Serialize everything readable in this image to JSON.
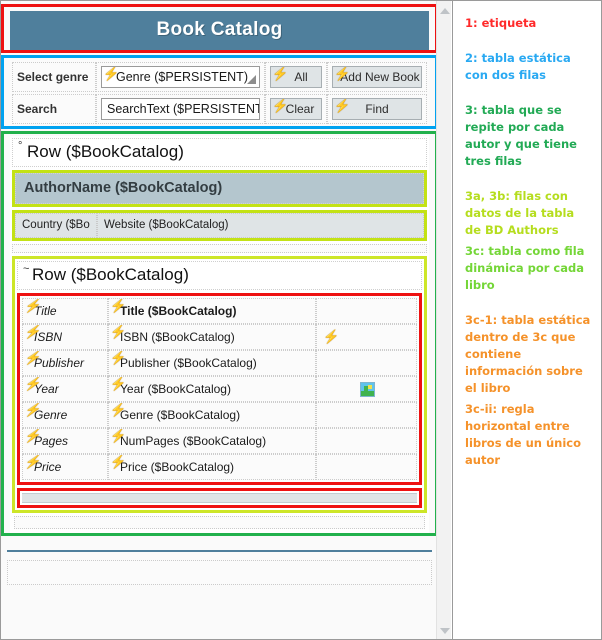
{
  "app": {
    "title": "Book Catalog"
  },
  "toolbar": {
    "select_genre_label": "Select genre",
    "genre_field_value": "Genre ($PERSISTENT)",
    "all_button": "All",
    "add_new_book_button": "Add New Book",
    "search_label": "Search",
    "search_field_value": "SearchText ($PERSISTENT)",
    "clear_button": "Clear",
    "find_button": "Find",
    "bolt_icon": "⚡"
  },
  "outer_row": {
    "mark": "°",
    "label": "Row ($BookCatalog)",
    "author_name": "AuthorName ($BookCatalog)",
    "country": "Country ($Bo",
    "website": "Website ($BookCatalog)"
  },
  "inner_row": {
    "mark": "~",
    "label": "Row ($BookCatalog)"
  },
  "detail_table": {
    "rows": [
      {
        "key": "Title",
        "value": "Title ($BookCatalog)",
        "extra": "bolt"
      },
      {
        "key": "ISBN",
        "value": "ISBN ($BookCatalog)",
        "extra": "bolt"
      },
      {
        "key": "Publisher",
        "value": "Publisher ($BookCatalog)",
        "extra": ""
      },
      {
        "key": "Year",
        "value": "Year ($BookCatalog)",
        "extra": "image"
      },
      {
        "key": "Genre",
        "value": "Genre ($BookCatalog)",
        "extra": ""
      },
      {
        "key": "Pages",
        "value": "NumPages ($BookCatalog)",
        "extra": ""
      },
      {
        "key": "Price",
        "value": "Price ($BookCatalog)",
        "extra": ""
      }
    ]
  },
  "notes": [
    {
      "text": "1: etiqueta",
      "color": "#ff2a2a"
    },
    {
      "text": "2: tabla estática con dos filas",
      "color": "#29a9f2"
    },
    {
      "text": "3: tabla que se repite por cada autor y que tiene tres filas",
      "color": "#22aa55"
    },
    {
      "text": "3a, 3b: filas con datos de la tabla de BD Authors",
      "color": "#b5dd1e"
    },
    {
      "text": "3c: tabla como fila dinámica por cada libro",
      "color": "#74d637"
    },
    {
      "text": "3c-1: tabla estática dentro de 3c que contiene información sobre el libro",
      "color": "#f5922a"
    },
    {
      "text": "3c-ii: regla horizontal entre libros de un único autor",
      "color": "#f5922a"
    }
  ],
  "colors": {
    "header_bg": "#4f7f9c",
    "outline_red": "#ee1111",
    "outline_blue": "#00a2f0",
    "outline_green": "#22b14c",
    "outline_lime": "#c3e215"
  },
  "scrollbar": {
    "up_arrow": "up-arrow",
    "down_arrow": "down-arrow"
  }
}
